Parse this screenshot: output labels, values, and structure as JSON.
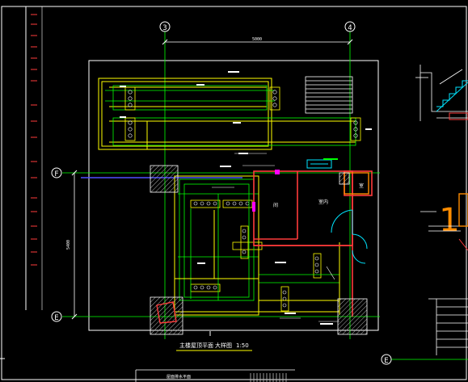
{
  "drawing": {
    "title": "主楼屋顶平面",
    "scale_label": "大样图",
    "scale": "1:50",
    "bottom_note": "屋面排水平面",
    "grid_axes": {
      "col_left": "3",
      "col_right": "4",
      "row_top": "F",
      "row_bottom": "E",
      "side_row": "E"
    },
    "overall_dim_top": "5000",
    "side_dim": "5400",
    "room_labels": {
      "room_1": "间",
      "room_2": "室内",
      "room_3": "室"
    },
    "large_mark": "1"
  },
  "colors": {
    "background": "#000000",
    "frame": "#ffffff",
    "grid_line": "#00ff00",
    "wall": "#ff3b3b",
    "beam": "#ffff00",
    "dim": "#ffffff",
    "accent_cyan": "#00e5ff",
    "accent_magenta": "#ff00ff",
    "orange": "#ff8c00",
    "hatch": "#c0c0c0"
  },
  "icons": [
    "grid-bubble-icon",
    "window-symbol-icon",
    "door-swing-icon",
    "stair-icon"
  ]
}
